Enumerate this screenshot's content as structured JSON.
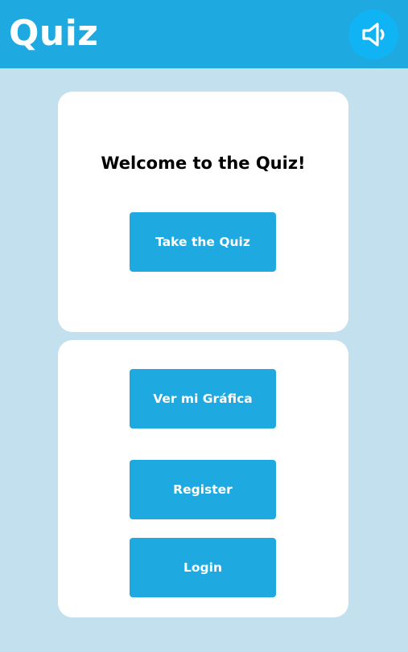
{
  "header": {
    "title": "Quiz",
    "sound_icon": "speaker-icon",
    "background_color": "#1ea9e1",
    "sound_button_color": "#10b4f4"
  },
  "welcome_card": {
    "heading": "Welcome to the Quiz!",
    "take_quiz_label": "Take the Quiz"
  },
  "actions_card": {
    "graph_label": "Ver mi Gráfica",
    "register_label": "Register",
    "login_label": "Login"
  },
  "colors": {
    "page_background": "#c2e0ee",
    "button": "#1ea9e1",
    "card": "#ffffff"
  }
}
